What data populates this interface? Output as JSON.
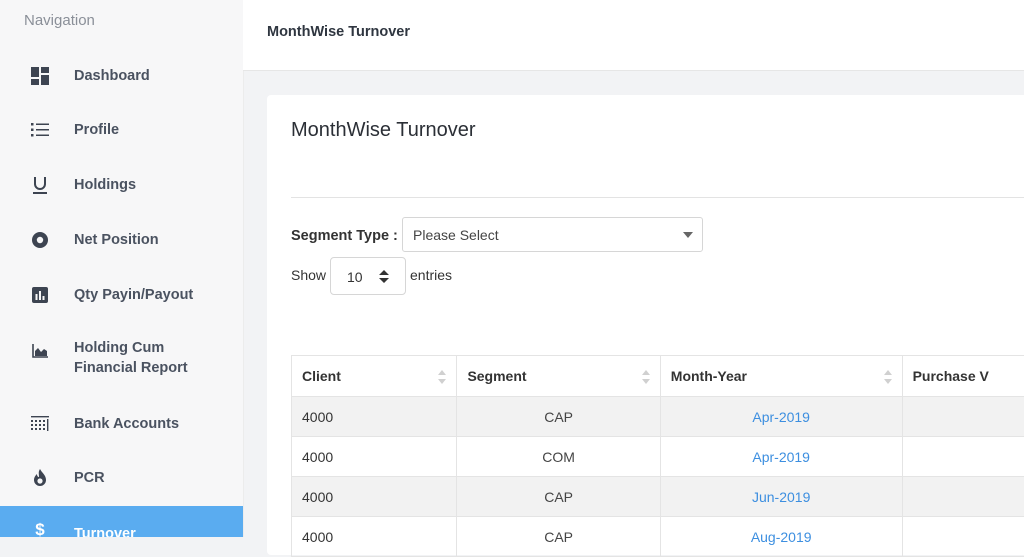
{
  "sidebar": {
    "heading": "Navigation",
    "items": [
      {
        "label": "Dashboard",
        "icon": "dashboard-icon"
      },
      {
        "label": "Profile",
        "icon": "list-icon"
      },
      {
        "label": "Holdings",
        "icon": "underline-u-icon"
      },
      {
        "label": "Net Position",
        "icon": "record-circle-icon"
      },
      {
        "label": "Qty Payin/Payout",
        "icon": "bar-chart-icon"
      },
      {
        "label": "Holding Cum\nFinancial Report",
        "icon": "area-chart-icon"
      },
      {
        "label": "Bank Accounts",
        "icon": "ledger-icon"
      },
      {
        "label": "PCR",
        "icon": "flame-icon"
      },
      {
        "label": "Turnover",
        "icon": "dollar-icon",
        "active": true
      }
    ]
  },
  "header": {
    "title": "MonthWise Turnover"
  },
  "card": {
    "title": "MonthWise Turnover",
    "segment_label": "Segment Type :",
    "segment_value": "Please Select",
    "show_label": "Show",
    "entries_value": "10",
    "entries_label": "entries"
  },
  "table": {
    "columns": [
      "Client",
      "Segment",
      "Month-Year",
      "Purchase V"
    ],
    "rows": [
      {
        "client": "4000",
        "segment": "CAP",
        "month": "Apr-2019"
      },
      {
        "client": "4000",
        "segment": "COM",
        "month": "Apr-2019"
      },
      {
        "client": "4000",
        "segment": "CAP",
        "month": "Jun-2019"
      },
      {
        "client": "4000",
        "segment": "CAP",
        "month": "Aug-2019"
      }
    ]
  },
  "colors": {
    "accent": "#5aacf0",
    "link": "#3d8fe0"
  }
}
